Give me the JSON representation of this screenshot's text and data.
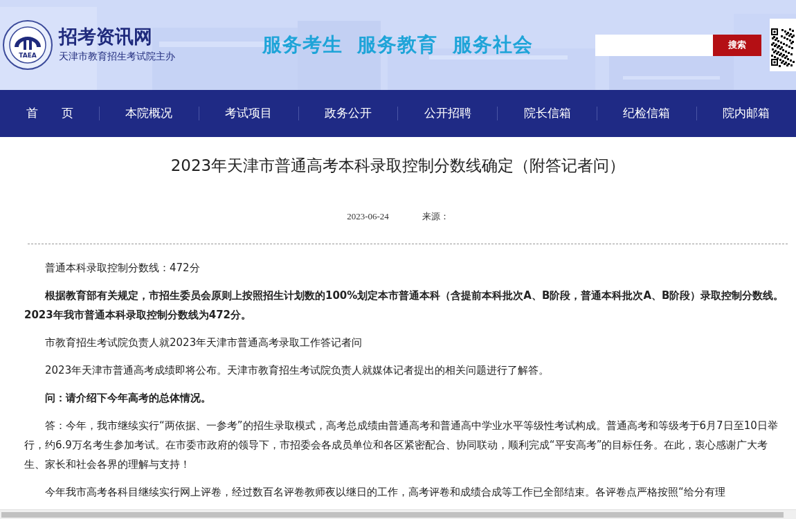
{
  "header": {
    "logo_text": "TAEA",
    "site_name": "招考资讯网",
    "subtitle": "天津市教育招生考试院主办",
    "slogan": "服务考生  服务教育  服务社会",
    "search": {
      "button": "搜索"
    }
  },
  "nav": [
    "首　　页",
    "本院概况",
    "考试项目",
    "政务公开",
    "公开招聘",
    "院长信箱",
    "纪检信箱",
    "院内邮箱"
  ],
  "article": {
    "title": "2023年天津市普通高考本科录取控制分数线确定（附答记者问）",
    "date": "2023-06-24",
    "source_label": "来源：",
    "paragraphs": [
      {
        "kind": "normal",
        "text": "普通本科录取控制分数线：472分"
      },
      {
        "kind": "bold",
        "text": "根据教育部有关规定，市招生委员会原则上按照招生计划数的100%划定本市普通本科（含提前本科批次A、B阶段，普通本科批次A、B阶段）录取控制分数线。2023年我市普通本科录取控制分数线为472分。"
      },
      {
        "kind": "normal",
        "text": "市教育招生考试院负责人就2023年天津市普通高考录取工作答记者问"
      },
      {
        "kind": "normal",
        "text": "2023年天津市普通高考成绩即将公布。天津市教育招生考试院负责人就媒体记者提出的相关问题进行了解答。"
      },
      {
        "kind": "bold",
        "text": "问：请介绍下今年高考的总体情况。"
      },
      {
        "kind": "normal",
        "text": "答：今年，我市继续实行“两依据、一参考”的招生录取模式，高考总成绩由普通高考和普通高中学业水平等级性考试构成。普通高考和等级考于6月7日至10日举行，约6.9万名考生参加考试。在市委市政府的领导下，市招委会各成员单位和各区紧密配合、协同联动，顺利完成“平安高考”的目标任务。在此，衷心感谢广大考生、家长和社会各界的理解与支持！"
      },
      {
        "kind": "normal",
        "text": "今年我市高考各科目继续实行网上评卷，经过数百名评卷教师夜以继日的工作，高考评卷和成绩合成等工作已全部结束。各评卷点严格按照“给分有理"
      }
    ]
  }
}
